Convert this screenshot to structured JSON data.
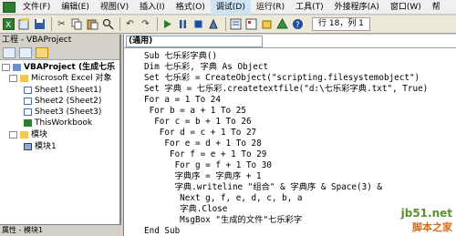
{
  "menubar": {
    "items": [
      "文件(F)",
      "编辑(E)",
      "视图(V)",
      "插入(I)",
      "格式(O)",
      "调试(D)",
      "运行(R)",
      "工具(T)",
      "外接程序(A)",
      "窗口(W)",
      "帮"
    ],
    "selected_index": 5
  },
  "toolbar": {
    "position_text": "行 18，列 1"
  },
  "project_panel": {
    "title": "工程 - VBAProject",
    "tree": [
      {
        "label": "VBAProject (生成七乐",
        "bold": true
      },
      {
        "label": "Microsoft Excel 对象",
        "bold": false
      },
      {
        "label": "Sheet1 (Sheet1)",
        "bold": false
      },
      {
        "label": "Sheet2 (Sheet2)",
        "bold": false
      },
      {
        "label": "Sheet3 (Sheet3)",
        "bold": false
      },
      {
        "label": "ThisWorkbook",
        "bold": false
      },
      {
        "label": "模块",
        "bold": false
      },
      {
        "label": "模块1",
        "bold": false
      }
    ],
    "props_title": "属性 - 模块1"
  },
  "code_window": {
    "object_combo": "(通用)",
    "lines": [
      "Sub 七乐彩字典()",
      "Dim 七乐彩, 字典 As Object",
      "Set 七乐彩 = CreateObject(\"scripting.filesystemobject\")",
      "Set 字典 = 七乐彩.createtextfile(\"d:\\七乐彩字典.txt\", True)",
      "For a = 1 To 24",
      " For b = a + 1 To 25",
      "  For c = b + 1 To 26",
      "   For d = c + 1 To 27",
      "    For e = d + 1 To 28",
      "     For f = e + 1 To 29",
      "      For g = f + 1 To 30",
      "      字典序 = 字典序 + 1",
      "      字典.writeline \"组合\" & 字典序 & Space(3) &",
      "       Next g, f, e, d, c, b, a",
      "       字典.Close",
      "       MsgBox \"生成的文件\"七乐彩字",
      "End Sub"
    ]
  },
  "watermark": {
    "url": "jb51.net",
    "name": "脚本之家"
  }
}
